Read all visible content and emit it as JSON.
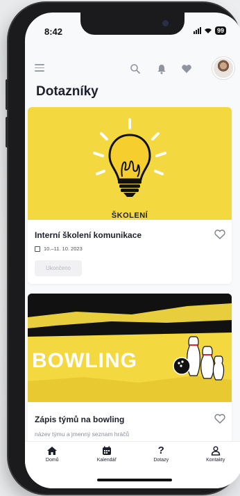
{
  "status_bar": {
    "time": "8:42",
    "battery": "99"
  },
  "header": {
    "menu_icon": "hamburger-icon",
    "search_icon": "search-icon",
    "notifications_icon": "bell-icon",
    "favorites_icon": "heart-icon"
  },
  "page": {
    "title": "Dotazníky"
  },
  "cards": [
    {
      "image_label": "ŠKOLENÍ",
      "title": "Interní školení komunikace",
      "date": "10.–11. 10. 2023",
      "status": "Ukončeno"
    },
    {
      "image_label": "BOWLING",
      "title": "Zápis týmů na bowling",
      "subtitle": "název týmu a jmenný seznam hráčů"
    }
  ],
  "colors": {
    "accent_yellow": "#F4D83F",
    "text_dark": "#1D1F2B",
    "muted": "#8A8E99"
  },
  "tabbar": {
    "items": [
      {
        "label": "Domů",
        "icon": "home-icon"
      },
      {
        "label": "Kalendář",
        "icon": "calendar-icon"
      },
      {
        "label": "Dotazy",
        "icon": "question-icon"
      },
      {
        "label": "Kontakty",
        "icon": "user-icon"
      }
    ]
  }
}
